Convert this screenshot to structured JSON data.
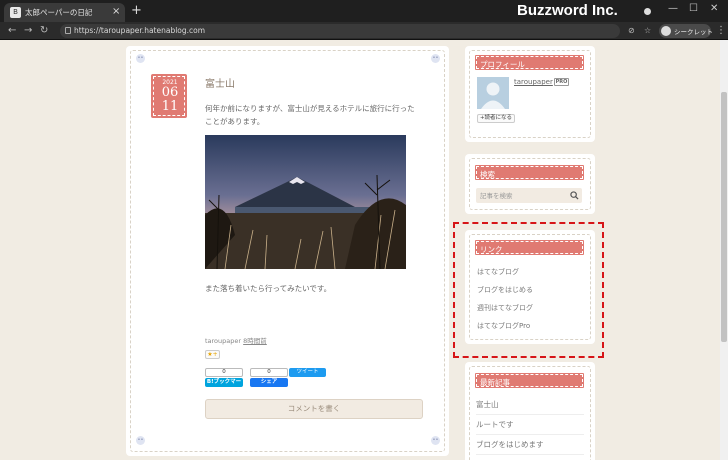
{
  "browser": {
    "tab_title": "太郎ペーパーの日記",
    "tab_close": "×",
    "new_tab": "+",
    "url": "https://taroupaper.hatenablog.com",
    "profile_label": "シークレット",
    "watermark": "Buzzword Inc.",
    "icons": [
      "back-icon",
      "forward-icon",
      "reload-icon",
      "lock-icon",
      "eye-off-icon",
      "star-icon",
      "menu-icon"
    ]
  },
  "article": {
    "date_year": "2021",
    "date_month": "06",
    "date_day": "11",
    "title": "富士山",
    "paragraph1": "何年か前になりますが、富士山が見えるホテルに旅行に行ったことがあります。",
    "paragraph2": "また落ち着いたら行ってみたいです。",
    "author": "taroupaper",
    "time_ago": "8時間前",
    "star_label": "★+",
    "bookmark_count": "0",
    "bookmark_label": "B!ブックマーク",
    "share_count": "0",
    "share_label": "シェア",
    "tweet_label": "ツイート",
    "comment_button": "コメントを書く"
  },
  "sidebar": {
    "profile_title": "プロフィール",
    "profile_name": "taroupaper",
    "pro_badge": "PRO",
    "follow_label": "+読者になる",
    "search_title": "検索",
    "search_placeholder": "記事を検索",
    "links_title": "リンク",
    "links": [
      "はてなブログ",
      "ブログをはじめる",
      "週刊はてなブログ",
      "はてなブログPro"
    ],
    "recent_title": "最新記事",
    "recent": [
      "富士山",
      "ルートです",
      "ブログをはじめます"
    ]
  },
  "colors": {
    "accent": "#e07a72",
    "highlight": "#d61518",
    "page_bg": "#f1ece3"
  }
}
